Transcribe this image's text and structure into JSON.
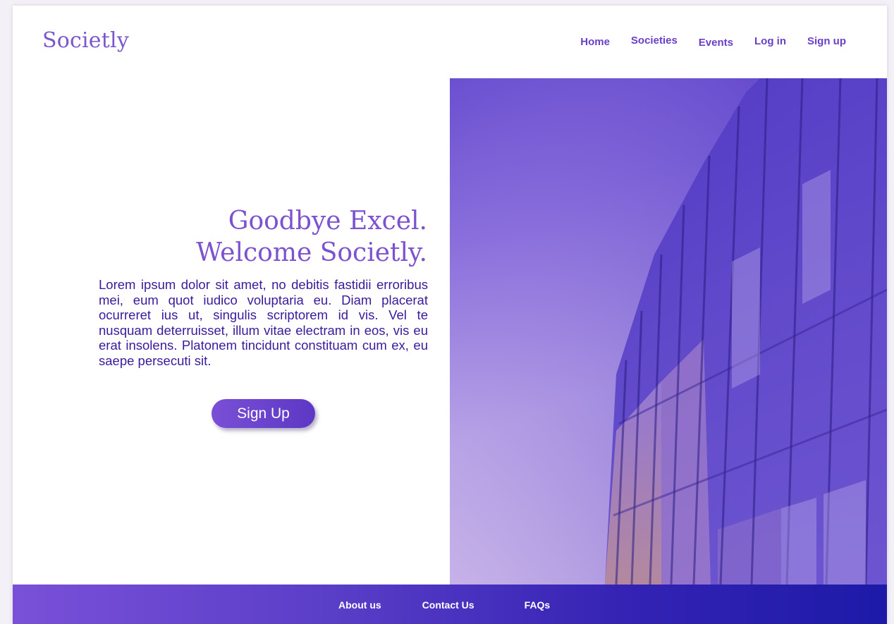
{
  "header": {
    "logo": "Societly",
    "nav": [
      {
        "label": "Home"
      },
      {
        "label": "Societies"
      },
      {
        "label": "Events"
      },
      {
        "label": "Log in"
      },
      {
        "label": "Sign up"
      }
    ]
  },
  "hero": {
    "headline_line1": "Goodbye Excel.",
    "headline_line2": "Welcome Societly.",
    "body": "Lorem ipsum dolor sit amet, no debitis fastidii erroribus mei, eum quot iudico voluptaria eu. Diam placerat ocurreret ius ut, singulis scriptorem id vis. Vel te nusquam deterruisset, illum vitae electram in eos, vis eu erat insolens. Platonem tincidunt constituam cum ex, eu saepe persecuti sit.",
    "cta_label": "Sign Up"
  },
  "footer": {
    "links": [
      {
        "label": "About us"
      },
      {
        "label": "Contact Us"
      },
      {
        "label": "FAQs"
      }
    ]
  },
  "colors": {
    "brand": "#7b56cc",
    "nav_text": "#6a3fc8",
    "body_text": "#3a1a9a",
    "footer_start": "#7a50d8",
    "footer_end": "#1d1aa8"
  }
}
